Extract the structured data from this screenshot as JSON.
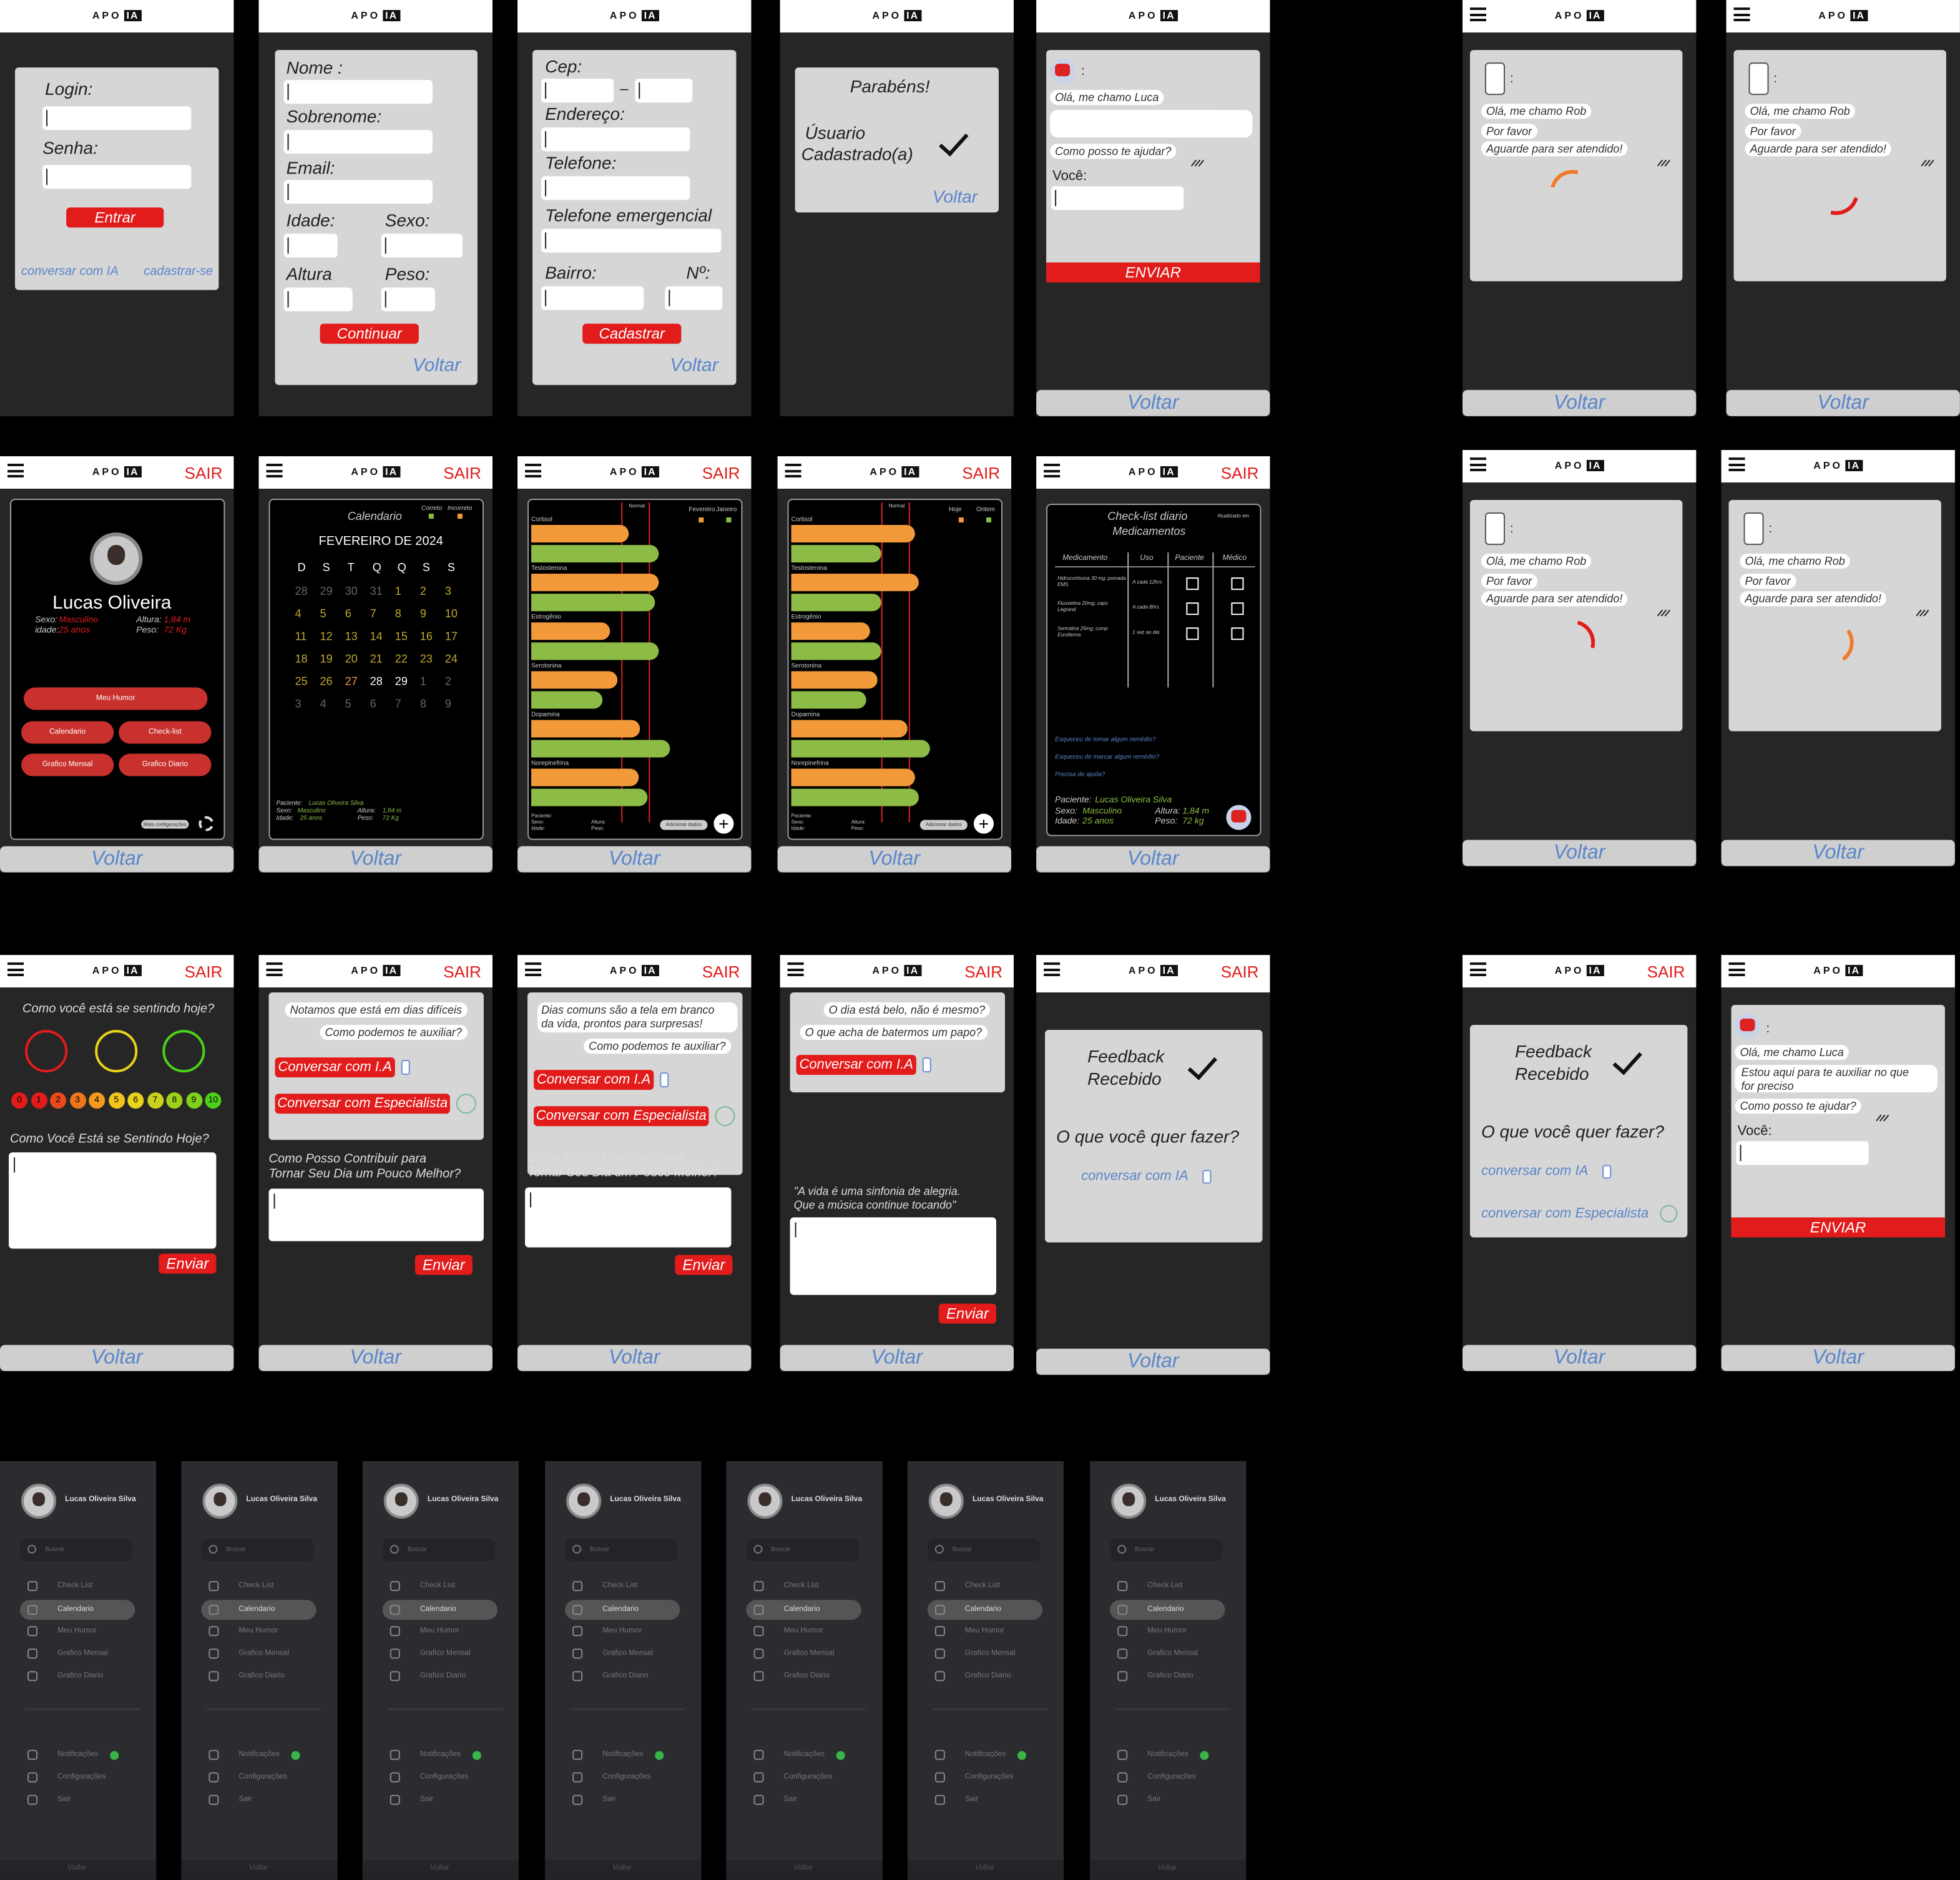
{
  "brand": {
    "logo_a": "APO",
    "logo_b": "IA",
    "sair": "SAIR",
    "voltar": "Voltar",
    "accent": "#e21b1b",
    "link_color": "#5a86c9"
  },
  "login": {
    "login": "Login:",
    "senha": "Senha:",
    "entrar": "Entrar",
    "chat_link": "conversar com IA",
    "register_link": "cadastrar-se"
  },
  "signup1": {
    "nome": "Nome :",
    "sobrenome": "Sobrenome:",
    "email": "Email:",
    "idade": "Idade:",
    "sexo": "Sexo:",
    "altura": "Altura",
    "peso": "Peso:",
    "continuar": "Continuar"
  },
  "signup2": {
    "cep": "Cep:",
    "dash": "–",
    "endereco": "Endereço:",
    "telefone": "Telefone:",
    "tel_emerg": "Telefone emergencial",
    "bairro": "Bairro:",
    "numero": "Nº:",
    "cadastrar": "Cadastrar"
  },
  "success": {
    "parabens": "Parabéns!",
    "line1": "Úsuario",
    "line2": "Cadastrado(a)"
  },
  "chat_ia": {
    "colon": ":",
    "b1": "Olá, me chamo Luca",
    "b2a": "Estou aqui para te auxiliar no que",
    "b2b": "for preciso",
    "b3": "Como posso te ajudar?",
    "voce": "Você:",
    "enviar": "ENVIAR"
  },
  "chat_rob": {
    "colon": ":",
    "b1": "Olá, me chamo Rob",
    "b2": "Por favor",
    "b3": "Aguarde para ser atendido!"
  },
  "profile": {
    "name": "Lucas Oliveira",
    "sexo": "Sexo:",
    "sexo_v": "Masculino",
    "idade": "idade:",
    "idade_v": "25 anos",
    "altura": "Altura:",
    "altura_v": "1,84 m",
    "peso": "Peso:",
    "peso_v": "72 Kg",
    "humor": "Meu Humor",
    "calendario": "Calendario",
    "checklist": "Check-list",
    "mensal": "Grafico Mensal",
    "diario": "Grafico Diario",
    "config": "Mais configurações"
  },
  "calendar": {
    "title": "Calendario",
    "leg1": "Correto",
    "leg2": "Incorreto",
    "month": "FEVEREIRO DE 2024",
    "week": [
      "D",
      "S",
      "T",
      "Q",
      "Q",
      "S",
      "S"
    ],
    "rows": [
      [
        "28",
        "29",
        "30",
        "31",
        "1",
        "2",
        "3"
      ],
      [
        "4",
        "5",
        "6",
        "7",
        "8",
        "9",
        "10"
      ],
      [
        "11",
        "12",
        "13",
        "14",
        "15",
        "16",
        "17"
      ],
      [
        "18",
        "19",
        "20",
        "21",
        "22",
        "23",
        "24"
      ],
      [
        "25",
        "26",
        "27",
        "28",
        "29",
        "1",
        "2"
      ],
      [
        "3",
        "4",
        "5",
        "6",
        "7",
        "8",
        "9"
      ]
    ],
    "paciente": "Paciente:",
    "paciente_v": "Lucas Oliveira Silva",
    "sexo": "Sexo:",
    "sexo_v": "Masculino",
    "idade": "Idade:",
    "idade_v": "25 anos",
    "altura": "Altura:",
    "altura_v": "1,84 m",
    "peso": "Peso:",
    "peso_v": "72 Kg"
  },
  "chart_data": [
    {
      "type": "bar",
      "title": "",
      "legend": [
        "Fevereiro",
        "Janeiro"
      ],
      "categories": [
        "Cortisol",
        "Testosterona",
        "Estrogênio",
        "Serotonina",
        "Dopamina",
        "Norepinefrina"
      ],
      "series": [
        {
          "name": "Fevereiro",
          "values": [
            0.52,
            0.68,
            0.42,
            0.46,
            0.58,
            0.57
          ]
        },
        {
          "name": "Janeiro",
          "values": [
            0.68,
            0.66,
            0.68,
            0.38,
            0.74,
            0.62
          ]
        }
      ]
    },
    {
      "type": "bar",
      "title": "",
      "legend": [
        "Hoje",
        "Ontem"
      ],
      "categories": [
        "Cortisol",
        "Testosterona",
        "Estrogênio",
        "Serotonina",
        "Dopamina",
        "Norepinefrina"
      ],
      "series": [
        {
          "name": "Hoje",
          "values": [
            0.66,
            0.68,
            0.42,
            0.46,
            0.62,
            0.66
          ]
        },
        {
          "name": "Ontem",
          "values": [
            0.48,
            0.48,
            0.48,
            0.4,
            0.74,
            0.68
          ]
        }
      ]
    }
  ],
  "graph": {
    "normal": "Normal",
    "add": "Adicionar dados",
    "paciente": "Paciente:",
    "sexo": "Sexo:",
    "idade": "Idade:",
    "altura": "Altura:",
    "peso": "Peso:"
  },
  "checklist": {
    "title1": "Check-list diario",
    "title2": "Medicamentos",
    "updated": "Atualizado em",
    "cols": [
      "Medicamento",
      "Uso",
      "Paciente",
      "Médico"
    ],
    "meds": [
      {
        "name": "Hidrocortisona 30 mg; pomada EMS",
        "uso": "A cada 12hrs"
      },
      {
        "name": "Fluoxetina 20mg; caps Legrand",
        "uso": "A cada 8hrs"
      },
      {
        "name": "Sertralina 25mg; comp Eurofarma",
        "uso": "1 vez ao dia"
      }
    ],
    "q1": "Esqueceu de tomar algum remédio?",
    "q2": "Esqueceu de marcar algum remédio?",
    "q3": "Precisa de ajuda?",
    "paciente": "Paciente:",
    "paciente_v": "Lucas Oliveira Silva",
    "sexo": "Sexo:",
    "sexo_v": "Masculino",
    "idade": "Idade:",
    "idade_v": "25 anos",
    "altura": "Altura:",
    "altura_v": "1,84 m",
    "peso": "Peso:",
    "peso_v": "72 kg"
  },
  "mood": {
    "question": "Como você está se sentindo hoje?",
    "scale": [
      "0",
      "1",
      "2",
      "3",
      "4",
      "5",
      "6",
      "7",
      "8",
      "9",
      "10"
    ],
    "prompt": "Como Você Está se Sentindo Hoje?",
    "enviar": "Enviar"
  },
  "hard": {
    "b1": "Notamos que está em dias difíceis",
    "b2": "Como podemos te auxiliar?",
    "ia": "Conversar com I.A",
    "esp": "Conversar com Especialista",
    "p1": "Como Posso Contribuir para",
    "p2": "Tornar Seu Dia um Pouco Melhor?",
    "enviar": "Enviar"
  },
  "common": {
    "b1a": "Dias comuns são a tela em branco",
    "b1b": "da vida, prontos para surpresas!",
    "b2": "Como podemos te auxiliar?",
    "ia": "Conversar com I.A",
    "esp": "Conversar com Especialista",
    "p1": "Como Posso Contribuir para",
    "p2": "Tornar Seu Dia um Pouco Melhor?",
    "enviar": "Enviar"
  },
  "good": {
    "b1": "O dia está belo, não é mesmo?",
    "b2": "O que acha de batermos um papo?",
    "ia": "Conversar com I.A",
    "q1": "\"A vida  é uma sinfonia de alegria.",
    "q2": "Que a música continue tocando\"",
    "enviar": "Enviar"
  },
  "feedback": {
    "f1": "Feedback",
    "f2": "Recebido",
    "q": "O que você quer fazer?",
    "ia": "conversar com IA",
    "esp": "conversar com Especialista"
  },
  "menu": {
    "name": "Lucas Oliveira Silva",
    "search": "Buscar",
    "items": [
      "Check List",
      "Calendario",
      "Meu Humor",
      "Grafico Mensal",
      "Grafico Diario"
    ],
    "bottom": [
      "Notificações",
      "Configurações",
      "Sair"
    ],
    "voltar": "Voltar"
  }
}
